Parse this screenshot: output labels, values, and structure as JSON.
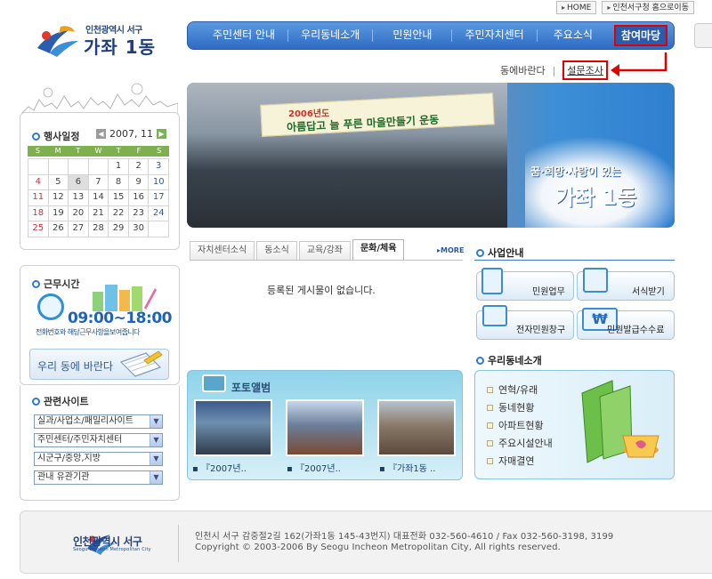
{
  "top_links": {
    "home": "HOME",
    "district": "인천서구청 홈으로이동"
  },
  "logo": {
    "subtitle": "인천광역시 서구",
    "title": "가좌 1동"
  },
  "nav": [
    "주민센터 안내",
    "우리동네소개",
    "민원안내",
    "주민자치센터",
    "주요소식",
    "참여마당"
  ],
  "submenu": {
    "item1": "동에바란다",
    "separator": "|",
    "item2": "설문조사"
  },
  "calendar": {
    "title": "행사일정",
    "month": "2007, 11",
    "weekdays": [
      "S",
      "M",
      "T",
      "W",
      "T",
      "F",
      "S"
    ],
    "days": [
      "",
      "",
      "",
      "",
      "1",
      "2",
      "3",
      "4",
      "5",
      "6",
      "7",
      "8",
      "9",
      "10",
      "11",
      "12",
      "13",
      "14",
      "15",
      "16",
      "17",
      "18",
      "19",
      "20",
      "21",
      "22",
      "23",
      "24",
      "25",
      "26",
      "27",
      "28",
      "29",
      "30",
      ""
    ]
  },
  "work": {
    "title": "근무시간",
    "hours": "09:00~18:00",
    "note": "전화번호와 해당근무사항을보여줍니다",
    "wish": "우리 동에 바란다"
  },
  "sites": {
    "title": "관련사이트",
    "selects": [
      "실과/사업소/패밀리사이트",
      "주민센터/주민자치센터",
      "시군구/중앙,지방",
      "관내 유관기관"
    ]
  },
  "banner": {
    "sign": "아름답고 늘 푸른 마을만들기 운동",
    "sign_year": "2006년도",
    "slogan_small": "꿈·희망·사랑이 있는",
    "slogan_big": "가좌 1동"
  },
  "board": {
    "tabs": [
      "자치센터소식",
      "동소식",
      "교육/강좌",
      "문화/체육"
    ],
    "more": "MORE",
    "empty": "등록된 게시물이 없습니다."
  },
  "album": {
    "title": "포토앨범",
    "captions": [
      "『2007년..",
      "『2007년..",
      "『가좌1동 .."
    ]
  },
  "business": {
    "title": "사업안내",
    "buttons": [
      "민원업무",
      "서식받기",
      "전자민원창구",
      "민원발급수수료"
    ]
  },
  "town": {
    "title": "우리동네소개",
    "items": [
      "연혁/유래",
      "동네현황",
      "아파트현황",
      "주요시설안내",
      "자매결연"
    ]
  },
  "footer": {
    "logo_name": "인천광역시 서구",
    "logo_en": "Seogu Incheon Metropolitan City",
    "address": "인천시 서구 감중절2길 162(가좌1동 145-43번지) 대표전화 032-560-4610 / Fax 032-560-3198, 3199",
    "copyright": "Copyright © 2003-2006 By Seogu Incheon Metropolitan City, All rights reserved."
  },
  "colors": {
    "nav": "#2e6bc4",
    "highlight": "#e00000",
    "calendar_head": "#7fb050"
  }
}
